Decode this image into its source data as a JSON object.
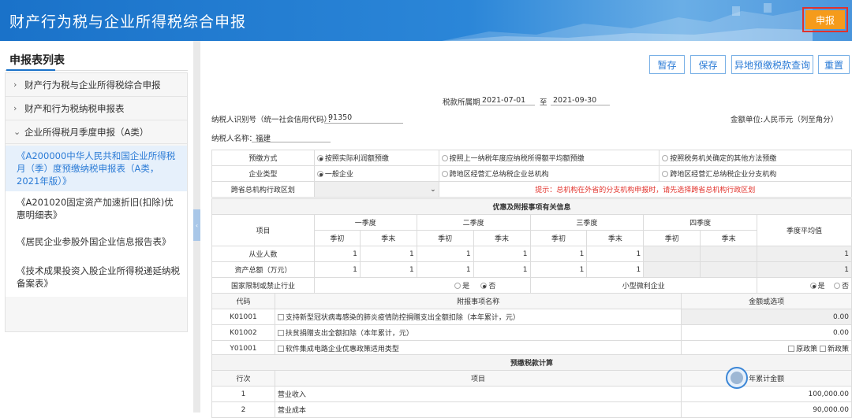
{
  "header": {
    "title": "财产行为税与企业所得税综合申报",
    "submit_label": "申报"
  },
  "sidebar": {
    "title": "申报表列表",
    "groups": [
      {
        "label": "财产行为税与企业所得税综合申报",
        "chevron": "chevron-right-icon"
      },
      {
        "label": "财产和行为税纳税申报表",
        "chevron": "chevron-right-icon"
      },
      {
        "label": "企业所得税月季度申报（A类）",
        "chevron": "chevron-down-icon"
      }
    ],
    "subitems": [
      {
        "label": "《A200000中华人民共和国企业所得税月（季）度预缴纳税申报表（A类，2021年版）》",
        "active": true
      },
      {
        "label": "《A201020固定资产加速折旧(扣除)优惠明细表》"
      },
      {
        "label": "《居民企业参股外国企业信息报告表》"
      },
      {
        "label": "《技术成果投资入股企业所得税递延纳税备案表》"
      }
    ],
    "collapse_glyph": "‹"
  },
  "toolbar": {
    "save_temp": "暂存",
    "save": "保存",
    "query": "异地预缴税款查询",
    "reset": "重置"
  },
  "form": {
    "period_label": "税款所属期",
    "period_start": "2021-07-01",
    "period_to": "至",
    "period_end": "2021-09-30",
    "taxpayer_id_label": "纳税人识别号（统一社会信用代码）：",
    "taxpayer_id": "91350",
    "unit_label": "金额单位:人民币元（列至角分）",
    "taxpayer_name_label": "纳税人名称：",
    "taxpayer_name": "福建"
  },
  "table1": {
    "prepay_label": "预缴方式",
    "prepay_opts": [
      "按照实际利润额预缴",
      "按照上一纳税年度应纳税所得额平均额预缴",
      "按照税务机关确定的其他方法预缴"
    ],
    "type_label": "企业类型",
    "type_opts": [
      "一般企业",
      "跨地区经营汇总纳税企业总机构",
      "跨地区经营汇总纳税企业分支机构"
    ],
    "region_label": "跨省总机构行政区划",
    "region_caret": "⌄",
    "hint": "提示：总机构在外省的分支机构申报时，请先选择跨省总机构行政区划",
    "section_title": "优惠及附报事项有关信息",
    "item_label": "项目",
    "quarters": [
      "一季度",
      "二季度",
      "三季度",
      "四季度"
    ],
    "q_avg": "季度平均值",
    "sub_cols": [
      "季初",
      "季末"
    ],
    "rows": [
      {
        "label": "从业人数",
        "values": [
          "1",
          "1",
          "1",
          "1",
          "1",
          "1"
        ],
        "avg": "1"
      },
      {
        "label": "资产总额（万元）",
        "values": [
          "1",
          "1",
          "1",
          "1",
          "1",
          "1"
        ],
        "avg": "1"
      }
    ],
    "restricted_label": "国家限制或禁止行业",
    "yes": "是",
    "no": "否",
    "small_label": "小型微利企业"
  },
  "table2": {
    "code_header": "代码",
    "name_header": "附报事项名称",
    "amount_header": "金额或选项",
    "rows": [
      {
        "code": "K01001",
        "name": "支持新型冠状病毒感染的肺炎疫情防控捐赠支出全额扣除（本年累计，元）",
        "value": "0.00"
      },
      {
        "code": "K01002",
        "name": "扶贫捐赠支出全额扣除（本年累计，元）",
        "value": "0.00"
      },
      {
        "code": "Y01001",
        "name": "软件集成电路企业优惠政策适用类型",
        "opt1": "原政策",
        "opt2": "新政策"
      }
    ]
  },
  "table3": {
    "section_title": "预缴税款计算",
    "line_header": "行次",
    "item_header": "项目",
    "amount_header": "本年累计金额",
    "amount_header_visible": "年累计金额",
    "rows": [
      {
        "no": "1",
        "item": "营业收入",
        "value": "100,000.00"
      },
      {
        "no": "2",
        "item": "营业成本",
        "value": "90,000.00"
      }
    ]
  }
}
